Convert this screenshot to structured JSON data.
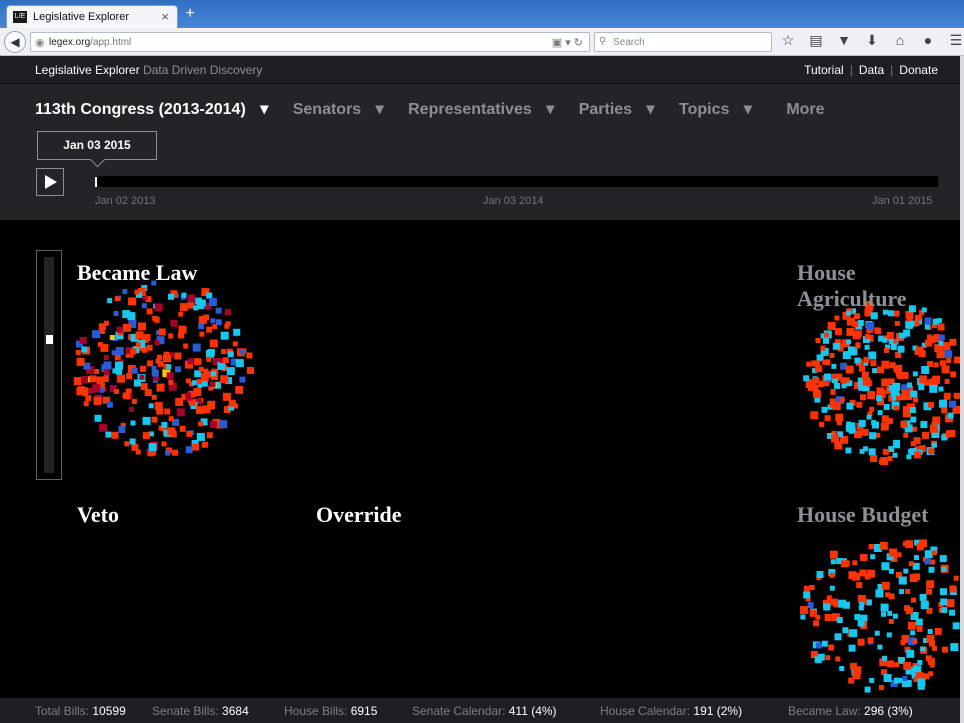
{
  "browser": {
    "tab_title": "Legislative Explorer",
    "tab_close": "×",
    "new_tab": "+",
    "favicon_text": "L/E",
    "url_host": "legex.org",
    "url_path": "/app.html",
    "search_placeholder": "Search",
    "toolbar_icons": [
      "star-icon",
      "reader-icon",
      "pocket-icon",
      "download-icon",
      "home-icon",
      "chat-icon",
      "menu-icon"
    ]
  },
  "app": {
    "brand": "Legislative Explorer",
    "tagline": "Data Driven Discovery",
    "links": [
      "Tutorial",
      "Data",
      "Donate"
    ],
    "menu": {
      "congress": "113th Congress (2013-2014)",
      "senators": "Senators",
      "representatives": "Representatives",
      "parties": "Parties",
      "topics": "Topics",
      "more": "More"
    },
    "current_date": "Jan 03 2015",
    "timeline_labels": [
      "Jan 02 2013",
      "Jan 03 2014",
      "Jan 01 2015"
    ],
    "timeline_progress": 0.0
  },
  "viz": {
    "clusters": [
      {
        "label": "Became Law",
        "style": "white"
      },
      {
        "label": "Veto",
        "style": "white"
      },
      {
        "label": "Override",
        "style": "white"
      },
      {
        "label": "House Agriculture",
        "style": "grey"
      },
      {
        "label": "House Budget",
        "style": "grey"
      }
    ],
    "colors": {
      "democrat": "#ff3300",
      "republican": "#17c7ee",
      "blue": "#2a5bd7",
      "maroon": "#a8002a",
      "yellow": "#f6c800"
    },
    "zoom_level": 0.62
  },
  "stats": {
    "total_label": "Total Bills:",
    "total_value": "10599",
    "senate_label": "Senate Bills:",
    "senate_value": "3684",
    "house_label": "House Bills:",
    "house_value": "6915",
    "senate_cal_label": "Senate Calendar:",
    "senate_cal_value": "411 (4%)",
    "house_cal_label": "House Calendar:",
    "house_cal_value": "191 (2%)",
    "law_label": "Became Law:",
    "law_value": "296 (3%)"
  }
}
